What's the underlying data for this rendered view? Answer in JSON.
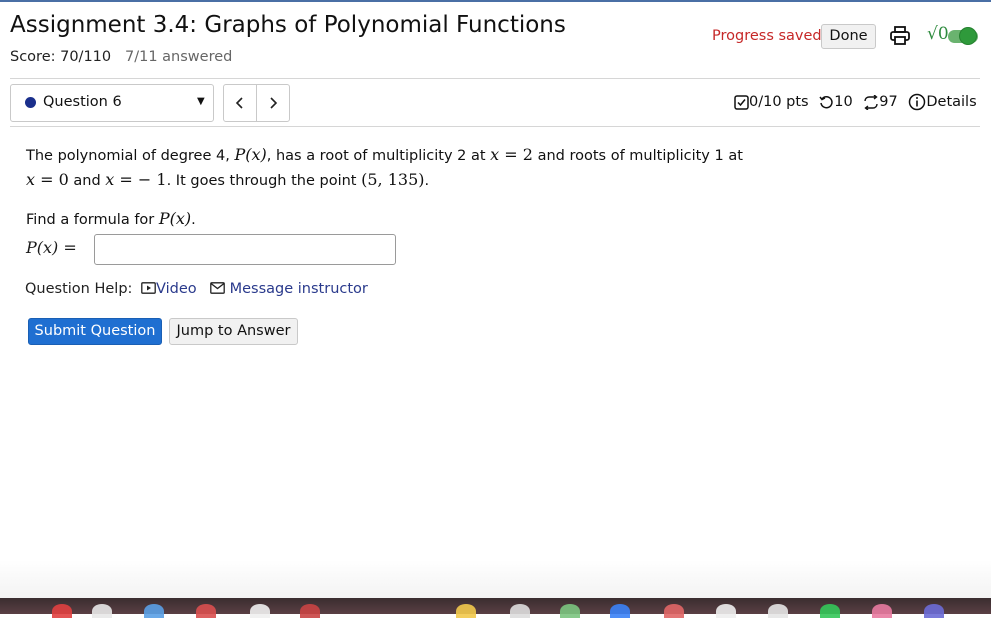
{
  "assignment": {
    "title": "Assignment 3.4: Graphs of Polynomial Functions",
    "score": "Score: 70/110",
    "answered": "7/11 answered"
  },
  "header": {
    "progress_status": "Progress saved",
    "done_label": "Done",
    "print_icon": "printer-icon",
    "math_toggle_label": "√0"
  },
  "question_nav": {
    "selected": "Question 6",
    "prev_icon": "chevron-left-icon",
    "next_icon": "chevron-right-icon"
  },
  "stats": {
    "points": "0/10 pts",
    "retries": "10",
    "attempts": "97",
    "details_label": "Details"
  },
  "question": {
    "text_1": "The polynomial of degree 4, ",
    "m_Px": "P(x)",
    "text_2": ", has a root of multiplicity 2 at ",
    "m_x": "x",
    "m_eq2": " = 2",
    "text_3": " and roots of multiplicity 1 at",
    "m_x2": "x",
    "m_eq0": " = 0",
    "text_4": " and ",
    "m_x3": "x",
    "m_eqm1": " = − 1",
    "text_5": ". It goes through the point ",
    "m_point": "(5, 135)",
    "text_6": ".",
    "find_text": "Find a formula for ",
    "find_math": "P(x)",
    "find_end": ".",
    "answer_label": "P(x) =",
    "answer_value": ""
  },
  "help": {
    "label": "Question Help:",
    "video": "Video",
    "message": "Message instructor"
  },
  "actions": {
    "submit": "Submit Question",
    "jump": "Jump to Answer"
  },
  "colors": {
    "accent": "#1f6fd1",
    "saved": "#c62828",
    "link": "#2a3a8c",
    "toggle": "#2f9a3b"
  }
}
